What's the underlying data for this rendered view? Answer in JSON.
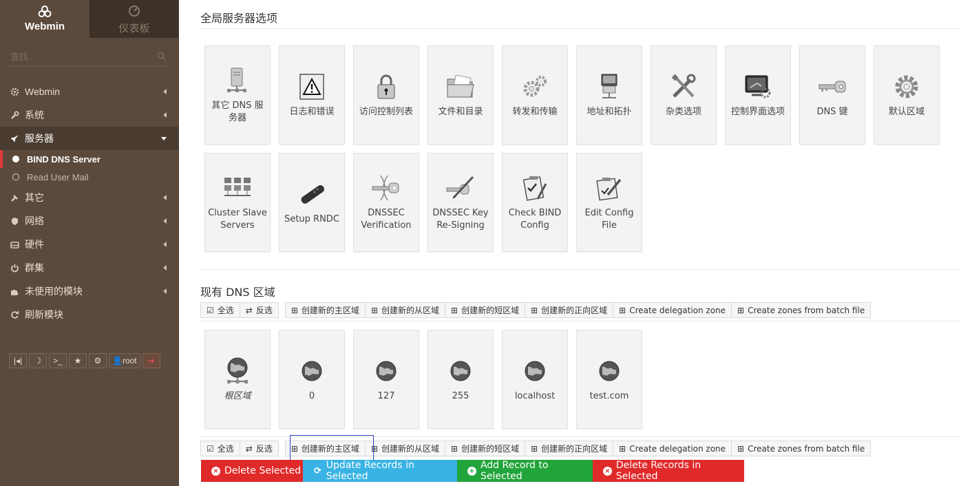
{
  "sidebar": {
    "tab_webmin": "Webmin",
    "tab_dashboard": "仪表板",
    "search_placeholder": "查找",
    "menu": [
      {
        "label": "Webmin",
        "icon": "gear-icon"
      },
      {
        "label": "系统",
        "icon": "wrench-icon"
      },
      {
        "label": "服务器",
        "icon": "rocket-icon"
      },
      {
        "label": "其它",
        "icon": "tools-icon"
      },
      {
        "label": "网络",
        "icon": "shield-icon"
      },
      {
        "label": "硬件",
        "icon": "drive-icon"
      },
      {
        "label": "群集",
        "icon": "power-icon"
      },
      {
        "label": "未使用的模块",
        "icon": "puzzle-icon"
      },
      {
        "label": "刷新模块",
        "icon": "refresh-icon"
      }
    ],
    "submenu": [
      {
        "label": "BIND DNS Server",
        "selected": true
      },
      {
        "label": "Read User Mail",
        "selected": false
      }
    ],
    "user_label": "root"
  },
  "global": {
    "title": "全局服务器选项",
    "tiles": [
      {
        "label": "其它 DNS 服务器",
        "icon": "server-icon"
      },
      {
        "label": "日志和错误",
        "icon": "warning-icon"
      },
      {
        "label": "访问控制列表",
        "icon": "padlock-icon"
      },
      {
        "label": "文件和目录",
        "icon": "folder-icon"
      },
      {
        "label": "转发和传输",
        "icon": "gears-icon"
      },
      {
        "label": "地址和拓扑",
        "icon": "computer-icon"
      },
      {
        "label": "杂类选项",
        "icon": "tools-icon"
      },
      {
        "label": "控制界面选项",
        "icon": "monitor-icon"
      },
      {
        "label": "DNS 键",
        "icon": "key-icon"
      },
      {
        "label": "默认区域",
        "icon": "cog-icon"
      },
      {
        "label": "Cluster Slave Servers",
        "icon": "cluster-icon"
      },
      {
        "label": "Setup RNDC",
        "icon": "remote-icon"
      },
      {
        "label": "DNSSEC Verification",
        "icon": "dnssec-key-icon"
      },
      {
        "label": "DNSSEC Key Re-Signing",
        "icon": "pen-key-icon"
      },
      {
        "label": "Check BIND Config",
        "icon": "checklist-icon"
      },
      {
        "label": "Edit Config File",
        "icon": "edit-file-icon"
      }
    ]
  },
  "zones": {
    "title": "现有 DNS 区域",
    "toolbar": [
      {
        "label": "全选",
        "icon": "check-square-icon"
      },
      {
        "label": "反选",
        "icon": "invert-icon"
      },
      {
        "label": "创建新的主区域",
        "icon": "plus-square-icon"
      },
      {
        "label": "创建新的从区域",
        "icon": "plus-square-icon"
      },
      {
        "label": "创建新的短区域",
        "icon": "plus-square-icon"
      },
      {
        "label": "创建新的正向区域",
        "icon": "plus-square-icon"
      },
      {
        "label": "Create delegation zone",
        "icon": "plus-square-icon"
      },
      {
        "label": "Create zones from batch file",
        "icon": "plus-square-icon"
      }
    ],
    "items": [
      {
        "label": "根区域",
        "italic": true
      },
      {
        "label": "0"
      },
      {
        "label": "127"
      },
      {
        "label": "255"
      },
      {
        "label": "localhost"
      },
      {
        "label": "test.com"
      }
    ]
  },
  "actions": [
    {
      "label": "Delete Selected",
      "color": "#e02a2a",
      "icon": "x-circle-icon"
    },
    {
      "label": "Update Records in Selected",
      "color": "#39b3e4",
      "icon": "refresh-icon"
    },
    {
      "label": "Add Record to Selected",
      "color": "#21a43a",
      "icon": "plus-circle-icon"
    },
    {
      "label": "Delete Records in Selected",
      "color": "#e02a2a",
      "icon": "x-circle-icon"
    }
  ]
}
